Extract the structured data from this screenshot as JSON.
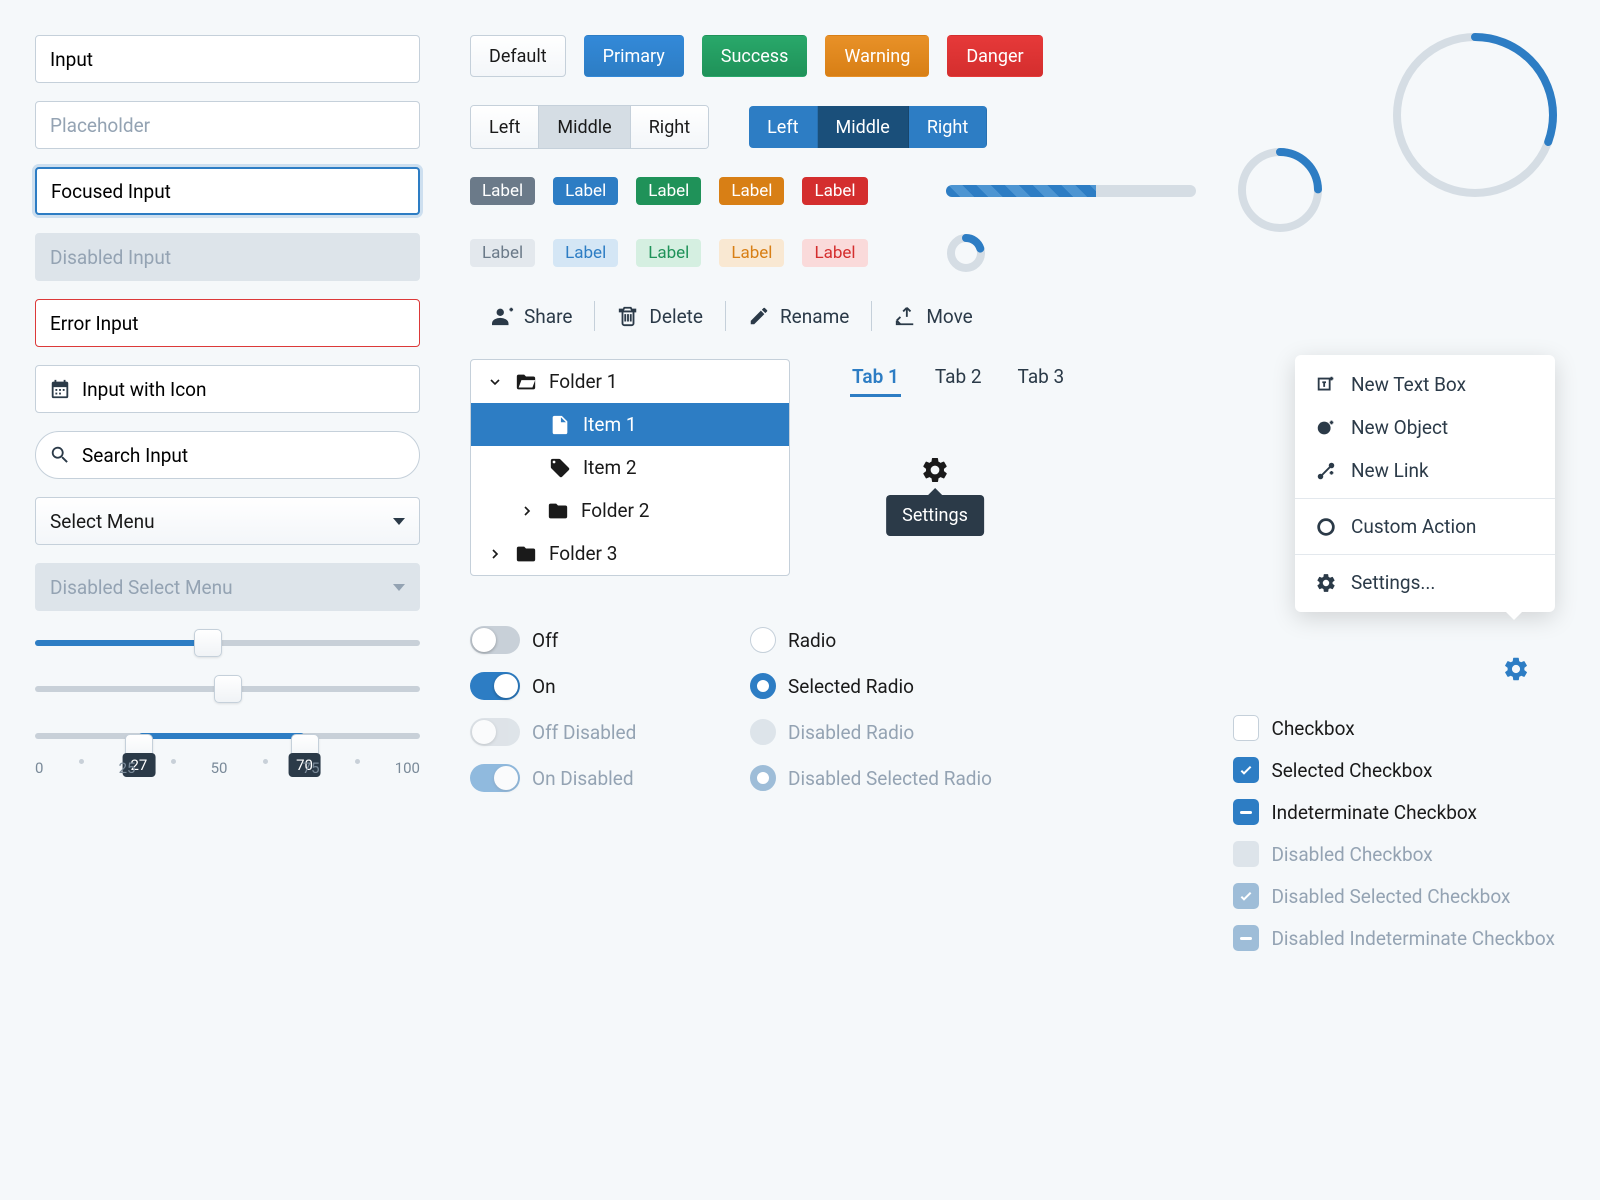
{
  "inputs": {
    "text": "Input",
    "placeholder": "Placeholder",
    "focused": "Focused Input",
    "disabled": "Disabled Input",
    "error": "Error Input",
    "with_icon": "Input with Icon",
    "search": "Search Input"
  },
  "selects": {
    "normal": "Select Menu",
    "disabled": "Disabled Select Menu"
  },
  "sliders": {
    "single": 45,
    "dual": 50,
    "range": {
      "min": 27,
      "max": 70,
      "ticks": [
        "0",
        "25",
        "50",
        "75",
        "100"
      ]
    }
  },
  "buttons": {
    "default": "Default",
    "primary": "Primary",
    "success": "Success",
    "warning": "Warning",
    "danger": "Danger"
  },
  "segments": {
    "a": [
      "Left",
      "Middle",
      "Right"
    ],
    "b": [
      "Left",
      "Middle",
      "Right"
    ]
  },
  "tag": "Label",
  "toolbar": {
    "share": "Share",
    "delete": "Delete",
    "rename": "Rename",
    "move": "Move"
  },
  "tree": {
    "f1": "Folder 1",
    "i1": "Item 1",
    "i2": "Item 2",
    "f2": "Folder 2",
    "f3": "Folder 3"
  },
  "tabs": [
    "Tab 1",
    "Tab 2",
    "Tab 3"
  ],
  "tooltip": "Settings",
  "menu": {
    "textbox": "New Text Box",
    "object": "New Object",
    "link": "New Link",
    "custom": "Custom Action",
    "settings": "Settings..."
  },
  "toggles": {
    "off": "Off",
    "on": "On",
    "off_dis": "Off Disabled",
    "on_dis": "On Disabled"
  },
  "radios": {
    "plain": "Radio",
    "sel": "Selected Radio",
    "dis": "Disabled Radio",
    "dis_sel": "Disabled Selected Radio"
  },
  "checks": {
    "plain": "Checkbox",
    "sel": "Selected Checkbox",
    "ind": "Indeterminate Checkbox",
    "dis": "Disabled Checkbox",
    "dis_sel": "Disabled Selected Checkbox",
    "dis_ind": "Disabled Indeterminate Checkbox"
  }
}
